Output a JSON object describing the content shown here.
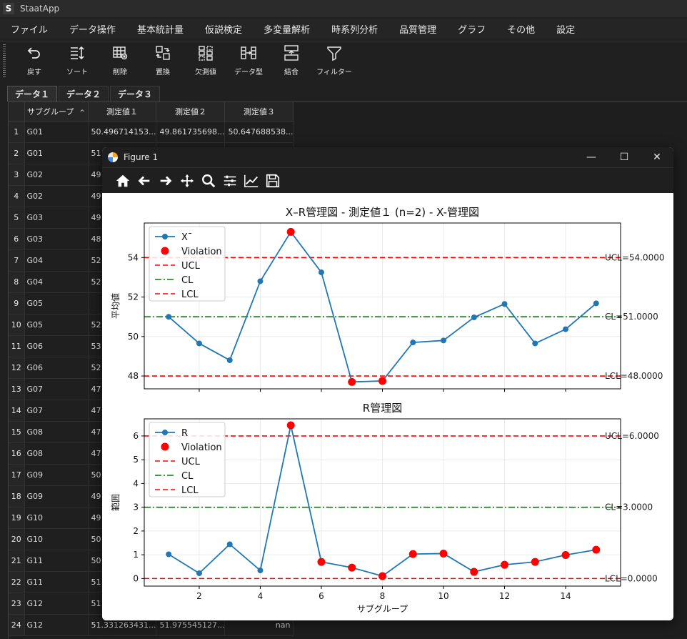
{
  "app": {
    "logo": "S",
    "title": "StaatApp"
  },
  "menu": [
    "ファイル",
    "データ操作",
    "基本統計量",
    "仮説検定",
    "多変量解析",
    "時系列分析",
    "品質管理",
    "グラフ",
    "その他",
    "設定"
  ],
  "toolbar": [
    {
      "label": "戻す",
      "icon": "undo-icon"
    },
    {
      "label": "ソート",
      "icon": "sort-icon"
    },
    {
      "label": "削除",
      "icon": "delete-icon"
    },
    {
      "label": "置換",
      "icon": "replace-icon"
    },
    {
      "label": "欠測値",
      "icon": "missing-values-icon"
    },
    {
      "label": "データ型",
      "icon": "data-type-icon"
    },
    {
      "label": "結合",
      "icon": "merge-icon"
    },
    {
      "label": "フィルター",
      "icon": "filter-icon"
    }
  ],
  "tabs": [
    "データ１",
    "データ２",
    "データ３"
  ],
  "table": {
    "headers": [
      "サブグループ",
      "測定値１",
      "測定値２",
      "測定値３"
    ],
    "sort_indicator": "^",
    "rows": [
      {
        "n": "1",
        "g": "G01",
        "v1": "50.496714153...",
        "v2": "49.861735698...",
        "v3": "50.647688538..."
      },
      {
        "n": "2",
        "g": "G01",
        "v1": "51",
        "v2": "",
        "v3": ""
      },
      {
        "n": "3",
        "g": "G02",
        "v1": "49",
        "v2": "",
        "v3": ""
      },
      {
        "n": "4",
        "g": "G02",
        "v1": "49",
        "v2": "",
        "v3": ""
      },
      {
        "n": "5",
        "g": "G03",
        "v1": "49",
        "v2": "",
        "v3": ""
      },
      {
        "n": "6",
        "g": "G03",
        "v1": "48",
        "v2": "",
        "v3": ""
      },
      {
        "n": "7",
        "g": "G04",
        "v1": "52",
        "v2": "",
        "v3": ""
      },
      {
        "n": "8",
        "g": "G04",
        "v1": "52",
        "v2": "",
        "v3": ""
      },
      {
        "n": "9",
        "g": "G05",
        "v1": "",
        "v2": "",
        "v3": ""
      },
      {
        "n": "10",
        "g": "G05",
        "v1": "52",
        "v2": "",
        "v3": ""
      },
      {
        "n": "11",
        "g": "G06",
        "v1": "53",
        "v2": "",
        "v3": ""
      },
      {
        "n": "12",
        "g": "G06",
        "v1": "52",
        "v2": "",
        "v3": ""
      },
      {
        "n": "13",
        "g": "G07",
        "v1": "47",
        "v2": "",
        "v3": ""
      },
      {
        "n": "14",
        "g": "G07",
        "v1": "47",
        "v2": "",
        "v3": ""
      },
      {
        "n": "15",
        "g": "G08",
        "v1": "47",
        "v2": "",
        "v3": ""
      },
      {
        "n": "16",
        "g": "G08",
        "v1": "47",
        "v2": "",
        "v3": ""
      },
      {
        "n": "17",
        "g": "G09",
        "v1": "50",
        "v2": "",
        "v3": ""
      },
      {
        "n": "18",
        "g": "G09",
        "v1": "49",
        "v2": "",
        "v3": ""
      },
      {
        "n": "19",
        "g": "G10",
        "v1": "49",
        "v2": "",
        "v3": ""
      },
      {
        "n": "20",
        "g": "G10",
        "v1": "50",
        "v2": "",
        "v3": ""
      },
      {
        "n": "21",
        "g": "G11",
        "v1": "50",
        "v2": "",
        "v3": ""
      },
      {
        "n": "22",
        "g": "G11",
        "v1": "51",
        "v2": "",
        "v3": ""
      },
      {
        "n": "23",
        "g": "G12",
        "v1": "51",
        "v2": "",
        "v3": ""
      },
      {
        "n": "24",
        "g": "G12",
        "v1": "51.331263431...",
        "v2": "51.975545127...",
        "v3": "nan"
      }
    ]
  },
  "figure": {
    "title": "Figure 1",
    "controls": {
      "minimize": "—",
      "maximize": "☐",
      "close": "✕"
    },
    "toolbar_icons": [
      "home-icon",
      "back-arrow-icon",
      "forward-arrow-icon",
      "pan-icon",
      "zoom-icon",
      "configure-subplots-icon",
      "edit-axes-icon",
      "save-icon"
    ]
  },
  "chart_data": [
    {
      "type": "line",
      "title": "X–R管理図 - 測定値１ (n=2) - X-管理図",
      "xlabel": "",
      "ylabel": "平均値",
      "x": [
        1,
        2,
        3,
        4,
        5,
        6,
        7,
        8,
        9,
        10,
        11,
        12,
        13,
        14,
        15
      ],
      "xlim": [
        0.2,
        15.8
      ],
      "ylim": [
        47.35,
        55.75
      ],
      "xticks": [
        2,
        4,
        6,
        8,
        10,
        12,
        14
      ],
      "yticks": [
        48,
        50,
        52,
        54
      ],
      "grid": true,
      "legend_position": "top-left",
      "series": [
        {
          "name": "X¯",
          "values": [
            51.0,
            49.65,
            48.8,
            52.8,
            55.3,
            53.25,
            47.7,
            47.75,
            49.7,
            49.8,
            50.97,
            51.65,
            49.65,
            50.37,
            51.68
          ],
          "color": "#1f77b4"
        }
      ],
      "violations": {
        "name": "Violation",
        "points": [
          [
            5,
            55.3
          ],
          [
            7,
            47.7
          ],
          [
            8,
            47.75
          ]
        ],
        "color": "#ff0000"
      },
      "lines": [
        {
          "name": "UCL",
          "value": 54.0,
          "label": "UCL=54.0000",
          "color": "#ff0000",
          "style": "dashed"
        },
        {
          "name": "CL",
          "value": 51.0,
          "label": "CL=51.0000",
          "color": "#008000",
          "style": "dashdot"
        },
        {
          "name": "LCL",
          "value": 48.0,
          "label": "LCL=48.0000",
          "color": "#ff0000",
          "style": "dashed"
        }
      ]
    },
    {
      "type": "line",
      "title": "R管理図",
      "xlabel": "サブグループ",
      "ylabel": "範囲",
      "x": [
        1,
        2,
        3,
        4,
        5,
        6,
        7,
        8,
        9,
        10,
        11,
        12,
        13,
        14,
        15
      ],
      "xlim": [
        0.2,
        15.8
      ],
      "ylim": [
        -0.32,
        6.72
      ],
      "xticks": [
        2,
        4,
        6,
        8,
        10,
        12,
        14
      ],
      "yticks": [
        0,
        1,
        2,
        3,
        4,
        5,
        6
      ],
      "grid": true,
      "legend_position": "top-left",
      "series": [
        {
          "name": "R",
          "values": [
            1.02,
            0.22,
            1.44,
            0.34,
            6.45,
            0.7,
            0.46,
            0.1,
            1.03,
            1.05,
            0.28,
            0.58,
            0.7,
            0.99,
            1.21
          ],
          "color": "#1f77b4"
        }
      ],
      "violations": {
        "name": "Violation",
        "points": [
          [
            5,
            6.45
          ],
          [
            6,
            0.7
          ],
          [
            7,
            0.46
          ],
          [
            8,
            0.1
          ],
          [
            9,
            1.03
          ],
          [
            10,
            1.05
          ],
          [
            11,
            0.28
          ],
          [
            12,
            0.58
          ],
          [
            13,
            0.7
          ],
          [
            14,
            0.99
          ],
          [
            15,
            1.21
          ]
        ],
        "color": "#ff0000"
      },
      "lines": [
        {
          "name": "UCL",
          "value": 6.0,
          "label": "UCL=6.0000",
          "color": "#ff0000",
          "style": "dashed"
        },
        {
          "name": "CL",
          "value": 3.0,
          "label": "CL=3.0000",
          "color": "#008000",
          "style": "dashdot"
        },
        {
          "name": "LCL",
          "value": 0.0,
          "label": "LCL=0.0000",
          "color": "#ff0000",
          "style": "dashed"
        }
      ]
    }
  ]
}
